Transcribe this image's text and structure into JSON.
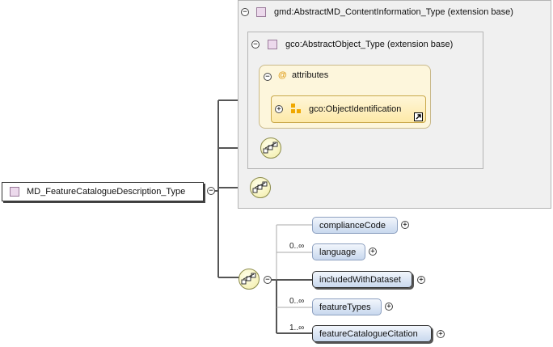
{
  "root_type": {
    "label": "MD_FeatureCatalogueDescription_Type",
    "expander": "−"
  },
  "extension_outer": {
    "title": "gmd:AbstractMD_ContentInformation_Type (extension base)",
    "expander": "−"
  },
  "extension_inner": {
    "title": "gco:AbstractObject_Type (extension base)",
    "expander": "−"
  },
  "attributes_group": {
    "label": "attributes",
    "at_symbol": "@",
    "expander": "−",
    "item": {
      "label": "gco:ObjectIdentification",
      "expander": "+"
    }
  },
  "sequence": {
    "expander": "−"
  },
  "elements": [
    {
      "label": "complianceCode",
      "cardinality": "",
      "expander": "+"
    },
    {
      "label": "language",
      "cardinality": "0..∞",
      "expander": "+"
    },
    {
      "label": "includedWithDataset",
      "cardinality": "",
      "expander": "+"
    },
    {
      "label": "featureTypes",
      "cardinality": "0..∞",
      "expander": "+"
    },
    {
      "label": "featureCatalogueCitation",
      "cardinality": "1..∞",
      "expander": "+"
    }
  ],
  "colors": {
    "element_fill": "#c8d8ee",
    "attribute_fill": "#fde9a8",
    "compositor_fill": "#f2eca8",
    "type_square": "#ecd9ec"
  }
}
